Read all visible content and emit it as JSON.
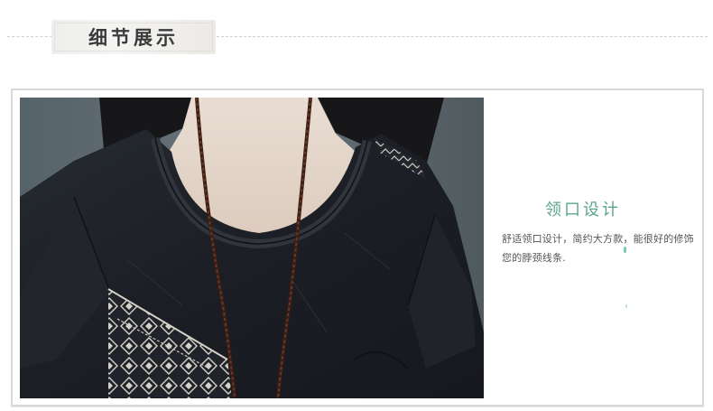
{
  "header": {
    "title": "细节展示"
  },
  "detail": {
    "feature_title": "领口设计",
    "description": "舒适领口设计，简约大方款，能很好的修饰您的脖颈线条."
  },
  "colors": {
    "accent": "#5aa58f",
    "garment": "#1c1f24",
    "backdrop": "#5f6b6f"
  },
  "image": {
    "subject": "black linen top round neckline close-up with braided cord necklace and geometric print panel"
  }
}
